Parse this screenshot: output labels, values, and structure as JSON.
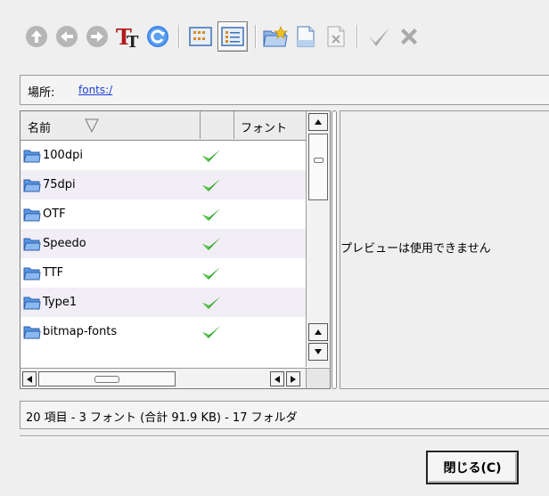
{
  "toolbar": {
    "buttons": [
      {
        "name": "up-button",
        "icon": "arrow-up-icon"
      },
      {
        "name": "back-button",
        "icon": "arrow-left-icon"
      },
      {
        "name": "forward-button",
        "icon": "arrow-right-icon"
      },
      {
        "name": "font-viewer-button",
        "icon": "font-tt-icon"
      },
      {
        "name": "reload-button",
        "icon": "reload-icon"
      },
      {
        "name": "icon-view-button",
        "icon": "icon-view-icon"
      },
      {
        "name": "detail-view-button",
        "icon": "detail-view-icon",
        "pressed": true
      },
      {
        "name": "new-folder-button",
        "icon": "new-folder-icon"
      },
      {
        "name": "new-document-button",
        "icon": "new-document-icon"
      },
      {
        "name": "delete-button",
        "icon": "delete-document-icon"
      },
      {
        "name": "accept-button",
        "icon": "check-icon"
      },
      {
        "name": "cancel-button",
        "icon": "x-icon"
      }
    ]
  },
  "location": {
    "label": "場所:",
    "value": "fonts:/"
  },
  "columns": {
    "name": "名前",
    "font": "フォント"
  },
  "files": [
    {
      "name": "100dpi",
      "enabled": true
    },
    {
      "name": "75dpi",
      "enabled": true
    },
    {
      "name": "OTF",
      "enabled": true
    },
    {
      "name": "Speedo",
      "enabled": true
    },
    {
      "name": "TTF",
      "enabled": true
    },
    {
      "name": "Type1",
      "enabled": true
    },
    {
      "name": "bitmap-fonts",
      "enabled": true
    }
  ],
  "preview": {
    "message": "プレビューは使用できません"
  },
  "status": {
    "text": "20 項目 - 3 フォント (合計 91.9 KB) - 17 フォルダ"
  },
  "close_button": {
    "label": "閉じる(C)"
  },
  "colors": {
    "folder": "#3b7fd6",
    "check": "#2fa12a",
    "link": "#1b3fd4",
    "disabled_icon": "#a9a9a9"
  }
}
